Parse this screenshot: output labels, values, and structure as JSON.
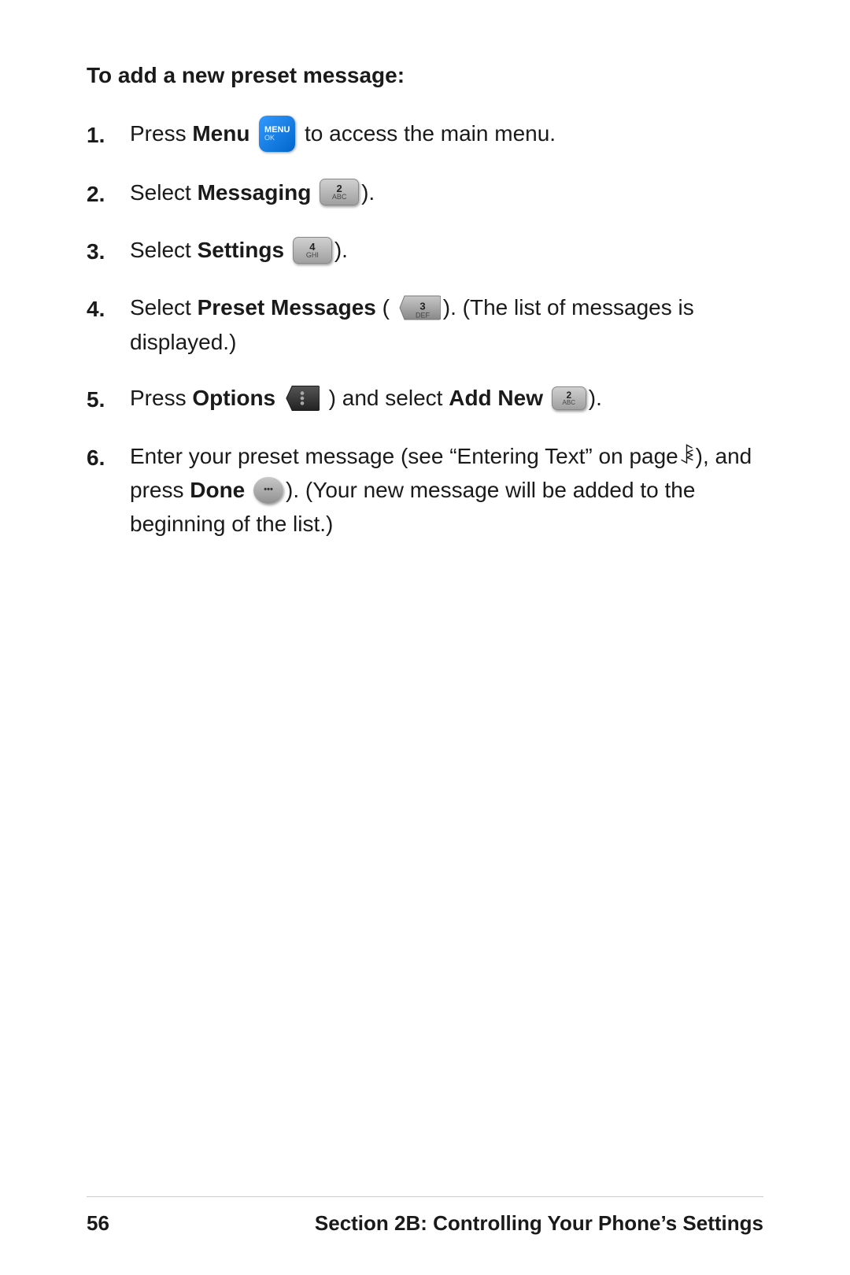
{
  "page": {
    "heading": "To add a new preset message:",
    "steps": [
      {
        "number": "1.",
        "text_before_bold": "Press ",
        "bold": "Menu",
        "text_after": " to access the main menu.",
        "icon": "menu"
      },
      {
        "number": "2.",
        "text_before_bold": "Select ",
        "bold": "Messaging",
        "text_after": ".",
        "icon": "key2"
      },
      {
        "number": "3.",
        "text_before_bold": "Select ",
        "bold": "Settings",
        "text_after": ".",
        "icon": "key4"
      },
      {
        "number": "4.",
        "text_before_bold": "Select ",
        "bold": "Preset Messages",
        "text_after": "). (The list of messages is displayed.)",
        "icon": "key3",
        "paren_open": "("
      },
      {
        "number": "5.",
        "text_before_bold": "Press ",
        "bold": "Options",
        "text_middle": ") and select ",
        "bold2": "Add New",
        "text_after": ").",
        "icon": "options",
        "icon2": "key2abc"
      },
      {
        "number": "6.",
        "text": "Enter your preset message (see “Entering Text” on page 34), and press ",
        "bold": "Done",
        "text_after": "). (Your new message will be added to the beginning of the list.)",
        "icon": "done"
      }
    ],
    "footer": {
      "page_number": "56",
      "section_title": "Section 2B: Controlling Your Phone’s Settings"
    }
  }
}
